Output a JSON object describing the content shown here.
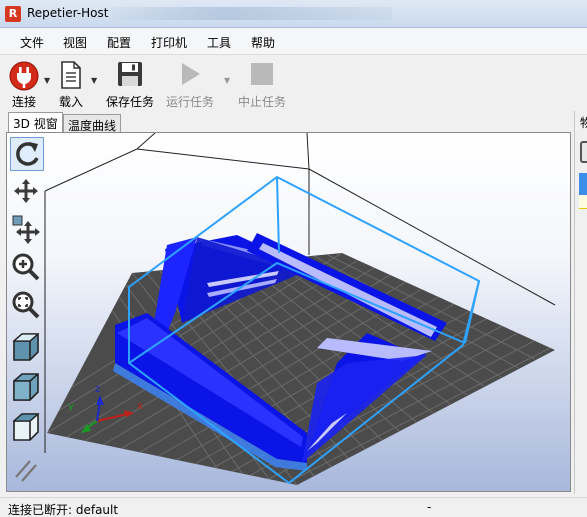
{
  "window": {
    "title": "Repetier-Host",
    "app_icon_letter": "R"
  },
  "menu": [
    "文件",
    "视图",
    "配置",
    "打印机",
    "工具",
    "帮助"
  ],
  "toolbar": {
    "connect": "连接",
    "load": "载入",
    "save_job": "保存任务",
    "run_job": "运行任务",
    "stop_job": "中止任务"
  },
  "tabs": {
    "view3d": "3D 视窗",
    "temperature": "温度曲线"
  },
  "right_panel": {
    "label": "物"
  },
  "axes": {
    "x": "x",
    "y": "y",
    "z": "z"
  },
  "status": {
    "connection": "连接已断开: default",
    "separator": "-"
  },
  "colors": {
    "model_blue": "#0a14e6",
    "model_light": "#b8bcff",
    "bounding_box": "#2ea2ff",
    "bed_grid": "#606060",
    "bed_dark": "#4b4b4b"
  }
}
